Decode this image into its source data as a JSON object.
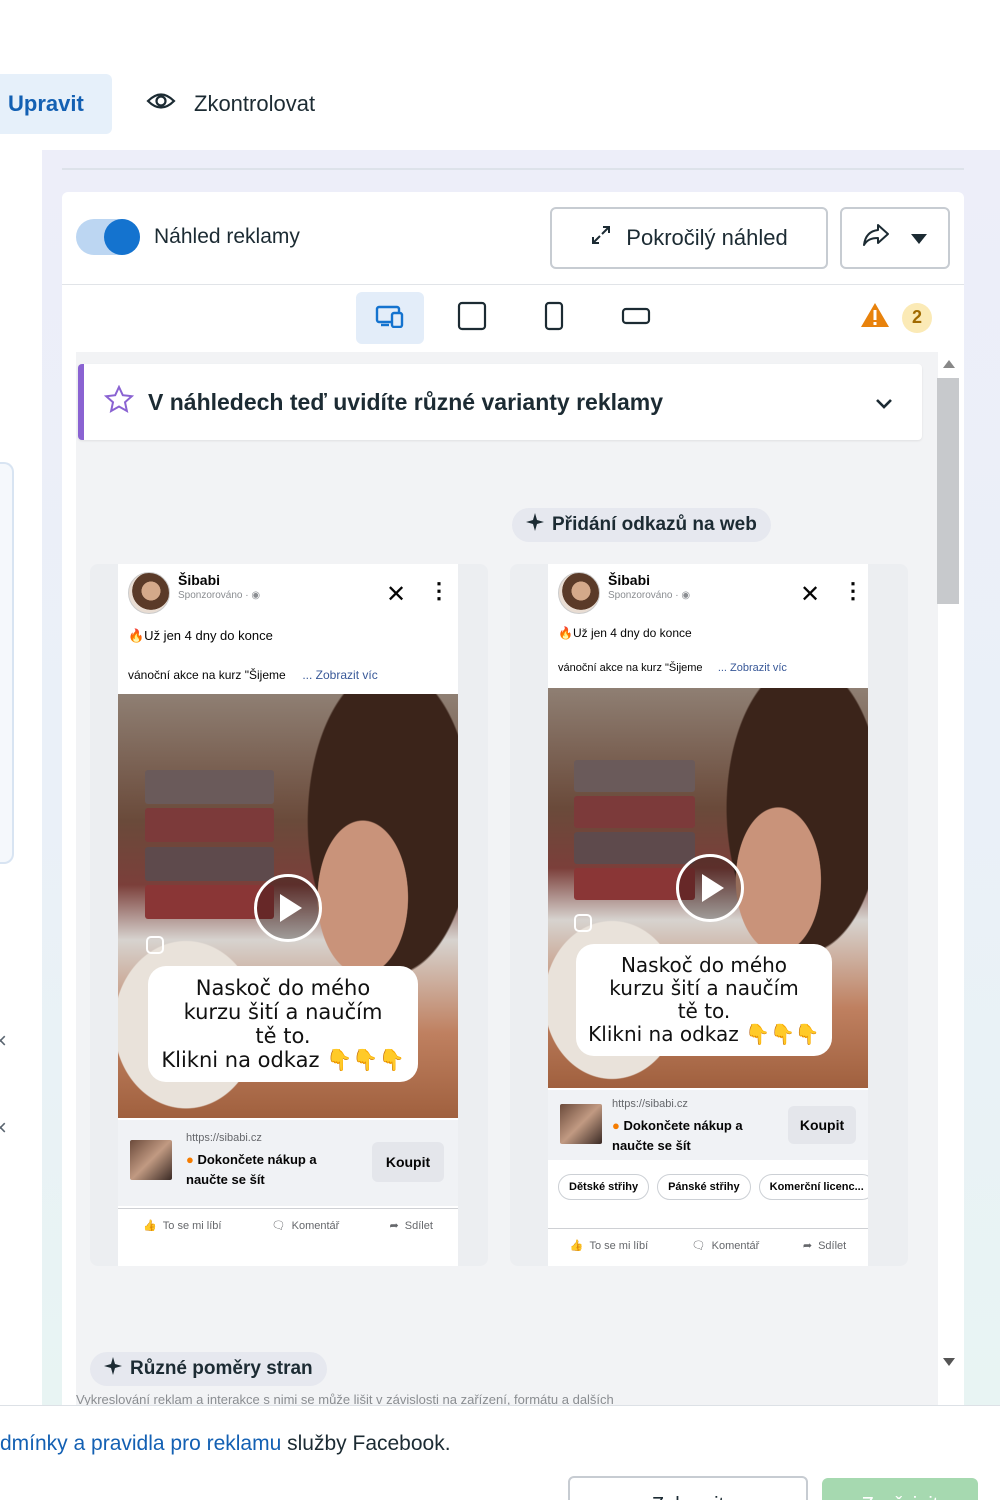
{
  "tabs": {
    "edit_label": "Upravit",
    "review_label": "Zkontrolovat"
  },
  "preview": {
    "toggle_label": "Náhled reklamy",
    "toggle_on": true,
    "advanced_button_label": "Pokročilý náhled",
    "format_buttons": [
      "all-placements-icon",
      "square-icon",
      "vertical-icon",
      "horizontal-icon"
    ],
    "warning_count": "2",
    "banner_text": "V náhledech teď uvidíte různé varianty reklamy",
    "chip_links": "Přidání odkazů na web",
    "chip_ratios": "Různé poměry stran",
    "description_partial": "Vykreslování reklam a interakce s nimi se může lišit v závislosti na zařízení, formátu a dalších"
  },
  "post": {
    "page_name": "Šibabi",
    "sponsored": "Sponzorováno · ",
    "text_line1": "🔥Už jen 4 dny do konce",
    "text_line2": "vánoční akce na kurz \"Šijeme",
    "see_more": "... Zobrazit víc",
    "caption_card1": "Naskoč do mého kurzu šití a naučím tě to.\nKlikni na odkaz 👇👇👇",
    "caption_line1": "Naskoč do mého",
    "caption_line2": "kurzu šití a naučím",
    "caption_line3": "tě to.",
    "caption_line4": "Klikni na odkaz 👇👇👇",
    "cta_url": "https://sibabi.cz",
    "cta_title_line1": "Dokončete nákup a",
    "cta_title_line2": "naučte se šít",
    "cta_button": "Koupit",
    "tags": [
      "Dětské střihy",
      "Pánské střihy",
      "Komerční licenc..."
    ],
    "action_like": "To se mi líbí",
    "action_comment": "Komentář",
    "action_share": "Sdílet"
  },
  "footer": {
    "text_prefix": "dmínky a pravidla pro reklamu",
    "text_suffix": " služby Facebook.",
    "button_secondary": "Zobrazit",
    "button_primary": "Zveřejnit"
  },
  "colors": {
    "accent": "#1473cf",
    "banner_accent": "#8a63d2",
    "warning": "#f5a623",
    "publish_disabled": "#a6d9b0"
  }
}
